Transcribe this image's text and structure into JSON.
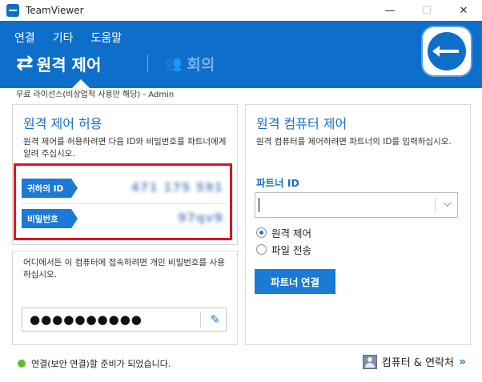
{
  "window": {
    "title": "TeamViewer",
    "minimize": "—",
    "maximize": "☐",
    "close": "✕"
  },
  "menu": [
    "연결",
    "기타",
    "도움말"
  ],
  "modes": {
    "remote": "원격 제어",
    "meeting": "회의"
  },
  "license": "무료 라이선스(비상업적 사용만 해당) - Admin",
  "allow": {
    "title": "원격 제어 허용",
    "desc": "원격 제어를 허용하려면 다음 ID와 비밀번호를 파트너에게 알려 주십시오.",
    "id_label": "귀하의 ID",
    "id_value": "471 175 591",
    "pw_label": "비밀번호",
    "pw_value": "97qv9"
  },
  "personal": {
    "desc": "어디에서든 이 컴퓨터에 접속하려면 개인 비밀번호를 사용하십시오.",
    "password_dots": "●●●●●●●●●●"
  },
  "control": {
    "title": "원격 컴퓨터 제어",
    "desc": "원격 컴퓨터를 제어하려면 파트너의 ID를 입력하십시오.",
    "partner_label": "파트너 ID",
    "partner_value": "",
    "options": [
      "원격 제어",
      "파일 전송"
    ],
    "selected": 0,
    "connect_label": "파트너 연결"
  },
  "status": {
    "text": "연결(보안 연결)할 준비가 되었습니다.",
    "color": "#5cbf2a"
  },
  "contacts_label": "컴퓨터 & 연락처",
  "accent": "#0e6fcb"
}
